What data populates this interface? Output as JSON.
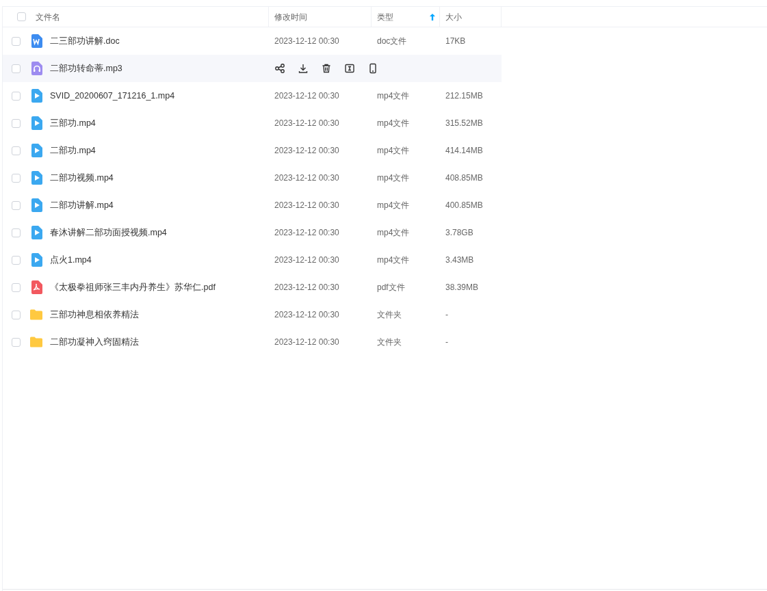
{
  "header": {
    "select_all": {
      "checked": false
    },
    "columns": [
      {
        "label": "文件名",
        "sorted": false
      },
      {
        "label": "修改时间",
        "sorted": false
      },
      {
        "label": "类型",
        "sorted": true
      },
      {
        "label": "大小",
        "sorted": false
      }
    ]
  },
  "rows": [
    {
      "kind": "doc",
      "name": "二三部功讲解.doc",
      "modified": "2023-12-12 00:30",
      "type": "doc文件",
      "size": "17KB",
      "checked": false,
      "hovered": false
    },
    {
      "kind": "audio",
      "name": "二部功转命蒂.mp3",
      "checked": false,
      "hovered": true
    },
    {
      "kind": "video",
      "name": "SVID_20200607_171216_1.mp4",
      "modified": "2023-12-12 00:30",
      "type": "mp4文件",
      "size": "212.15MB",
      "checked": false,
      "hovered": false
    },
    {
      "kind": "video",
      "name": "三部功.mp4",
      "modified": "2023-12-12 00:30",
      "type": "mp4文件",
      "size": "315.52MB",
      "checked": false,
      "hovered": false
    },
    {
      "kind": "video",
      "name": "二部功.mp4",
      "modified": "2023-12-12 00:30",
      "type": "mp4文件",
      "size": "414.14MB",
      "checked": false,
      "hovered": false
    },
    {
      "kind": "video",
      "name": "二部功视频.mp4",
      "modified": "2023-12-12 00:30",
      "type": "mp4文件",
      "size": "408.85MB",
      "checked": false,
      "hovered": false
    },
    {
      "kind": "video",
      "name": "二部功讲解.mp4",
      "modified": "2023-12-12 00:30",
      "type": "mp4文件",
      "size": "400.85MB",
      "checked": false,
      "hovered": false
    },
    {
      "kind": "video",
      "name": "春沐讲解二部功面授视频.mp4",
      "modified": "2023-12-12 00:30",
      "type": "mp4文件",
      "size": "3.78GB",
      "checked": false,
      "hovered": false
    },
    {
      "kind": "video",
      "name": "点火1.mp4",
      "modified": "2023-12-12 00:30",
      "type": "mp4文件",
      "size": "3.43MB",
      "checked": false,
      "hovered": false
    },
    {
      "kind": "pdf",
      "name": "《太极拳祖师张三丰内丹养生》苏华仁.pdf",
      "modified": "2023-12-12 00:30",
      "type": "pdf文件",
      "size": "38.39MB",
      "checked": false,
      "hovered": false
    },
    {
      "kind": "folder",
      "name": "三部功神息相依养精法",
      "modified": "2023-12-12 00:30",
      "type": "文件夹",
      "size": "-",
      "checked": false,
      "hovered": false
    },
    {
      "kind": "folder",
      "name": "二部功凝神入窍固精法",
      "modified": "2023-12-12 00:30",
      "type": "文件夹",
      "size": "-",
      "checked": false,
      "hovered": false
    }
  ]
}
